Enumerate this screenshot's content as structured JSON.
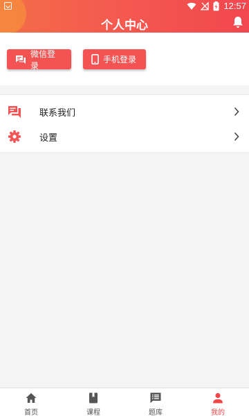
{
  "status_bar": {
    "time": "12:57"
  },
  "header": {
    "title": "个人中心"
  },
  "login": {
    "wechat_label": "微信登录",
    "phone_label": "手机登录"
  },
  "menu": {
    "items": [
      {
        "label": "联系我们",
        "icon": "chat-icon"
      },
      {
        "label": "设置",
        "icon": "gear-icon"
      }
    ]
  },
  "bottom_nav": {
    "items": [
      {
        "label": "首页",
        "icon": "home-icon",
        "active": false
      },
      {
        "label": "课程",
        "icon": "book-icon",
        "active": false
      },
      {
        "label": "题库",
        "icon": "question-bank-icon",
        "active": false
      },
      {
        "label": "我的",
        "icon": "person-icon",
        "active": true
      }
    ]
  },
  "colors": {
    "accent": "#f45353",
    "active_tab": "#f04848",
    "header_gradient_start": "#f46d48",
    "header_gradient_end": "#f1474f"
  }
}
